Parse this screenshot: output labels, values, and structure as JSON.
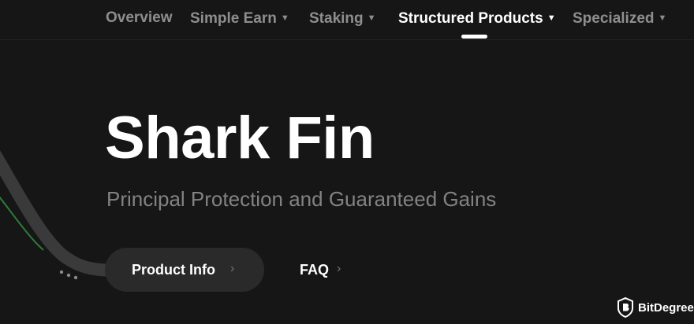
{
  "nav": {
    "items": [
      {
        "label": "Overview",
        "caret": ""
      },
      {
        "label": "Simple Earn",
        "caret": "▼"
      },
      {
        "label": "Staking",
        "caret": "▼"
      },
      {
        "label": "Structured Products",
        "caret": "▼"
      },
      {
        "label": "Specialized",
        "caret": "▼"
      }
    ],
    "active": "Structured Products"
  },
  "hero": {
    "title": "Shark Fin",
    "subtitle": "Principal Protection and Guaranteed Gains"
  },
  "buttons": {
    "product_info": "Product Info",
    "faq": "FAQ",
    "chevron": "›"
  },
  "watermark": {
    "text": "BitDegree"
  },
  "colors": {
    "background": "#161616",
    "nav_inactive": "#8e8e8e",
    "nav_active": "#ffffff",
    "subtitle": "#828282",
    "button_bg": "#2a2a2a",
    "accent_green": "#2e7d3a"
  },
  "icons": {
    "caret": "caret-down-icon",
    "chevron": "chevron-right-icon",
    "watermark": "bitdegree-logo-icon"
  }
}
